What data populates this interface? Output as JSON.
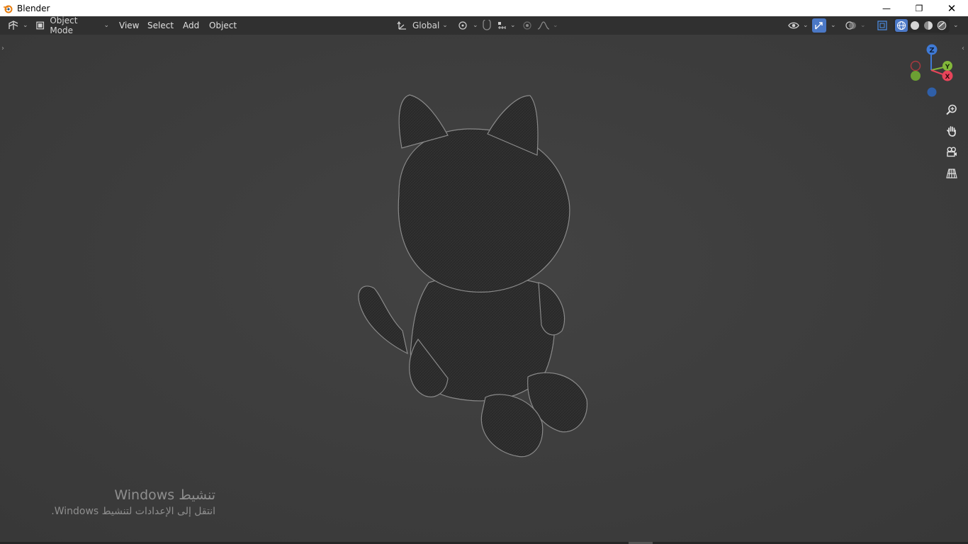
{
  "window": {
    "title": "Blender",
    "controls": {
      "minimize": "—",
      "maximize": "❐",
      "close": "✕"
    }
  },
  "header": {
    "editor_type_icon": "editor-type-3d-viewport-icon",
    "mode": "Object Mode",
    "menus": {
      "view": "View",
      "select": "Select",
      "add": "Add",
      "object": "Object"
    },
    "transform_orientation": "Global"
  },
  "viewport": {
    "object": "cat figure (sculpted mesh)",
    "axes": {
      "z": "Z",
      "y": "Y",
      "x": "X"
    },
    "colors": {
      "x_axis": "#e8445a",
      "y_axis": "#83b83a",
      "z_axis": "#3f7ad6",
      "background": "#3d3d3d",
      "header": "#303030",
      "active_tool": "#4b78c6"
    }
  },
  "watermark": {
    "line1": "تنشيط Windows",
    "line2": "انتقل إلى الإعدادات لتنشيط Windows."
  }
}
